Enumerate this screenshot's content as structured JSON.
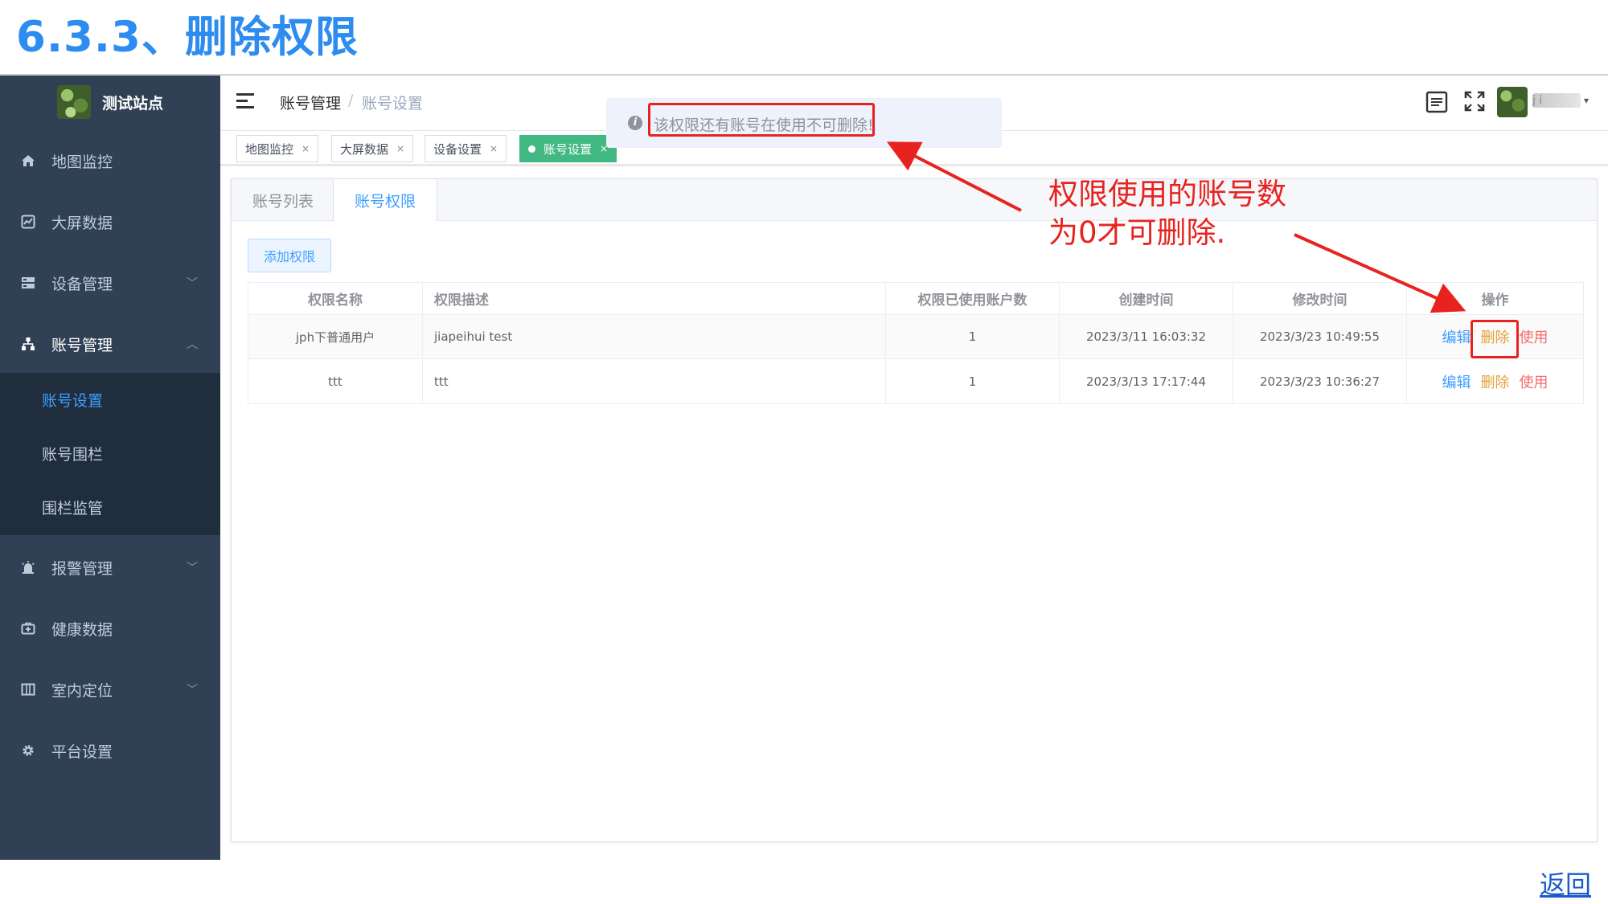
{
  "doc": {
    "title": "6.3.3、删除权限",
    "back_link": "返回"
  },
  "sidebar": {
    "logo_text": "测试站点",
    "items": [
      {
        "label": "地图监控",
        "icon": "home-icon"
      },
      {
        "label": "大屏数据",
        "icon": "chart-icon"
      },
      {
        "label": "设备管理",
        "icon": "server-icon",
        "has_arrow": true
      },
      {
        "label": "账号管理",
        "icon": "sitemap-icon",
        "has_arrow": true,
        "expanded": true
      },
      {
        "label": "报警管理",
        "icon": "alarm-icon",
        "has_arrow": true
      },
      {
        "label": "健康数据",
        "icon": "medkit-icon"
      },
      {
        "label": "室内定位",
        "icon": "map-icon",
        "has_arrow": true
      },
      {
        "label": "平台设置",
        "icon": "gear-icon"
      }
    ],
    "sub_items": [
      {
        "label": "账号设置",
        "current": true
      },
      {
        "label": "账号围栏"
      },
      {
        "label": "围栏监管"
      }
    ]
  },
  "header": {
    "breadcrumb": [
      "账号管理",
      "账号设置"
    ],
    "breadcrumb_sep": "/",
    "username": "j i",
    "caret": "▾"
  },
  "tags": [
    {
      "label": "地图监控",
      "close": "×"
    },
    {
      "label": "大屏数据",
      "close": "×"
    },
    {
      "label": "设备设置",
      "close": "×"
    },
    {
      "label": "账号设置",
      "close": "×",
      "active": true
    }
  ],
  "toast": {
    "icon": "i",
    "message": "该权限还有账号在使用不可删除!"
  },
  "tabs": [
    {
      "label": "账号列表"
    },
    {
      "label": "账号权限",
      "active": true
    }
  ],
  "add_button": "添加权限",
  "table": {
    "columns": [
      "权限名称",
      "权限描述",
      "权限已使用账户数",
      "创建时间",
      "修改时间",
      "操作"
    ],
    "rows": [
      {
        "name": "jph下普通用户",
        "desc": "jiapeihui test",
        "count": "1",
        "created": "2023/3/11 16:03:32",
        "modified": "2023/3/23 10:49:55"
      },
      {
        "name": "ttt",
        "desc": "ttt",
        "count": "1",
        "created": "2023/3/13 17:17:44",
        "modified": "2023/3/23 10:36:27"
      }
    ],
    "actions": {
      "edit": "编辑",
      "delete": "删除",
      "use": "使用"
    }
  },
  "annotation": {
    "line1": "权限使用的账号数",
    "line2": "为0才可删除."
  },
  "colors": {
    "sidebar": "#304156",
    "primary": "#409eff",
    "tag_active": "#42b983",
    "annotation": "#e8231f",
    "title": "#2d8cf0"
  }
}
